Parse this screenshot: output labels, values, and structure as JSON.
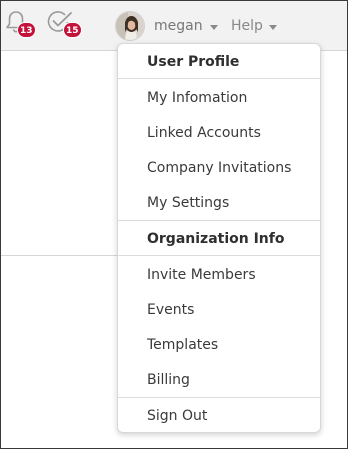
{
  "header": {
    "notifications": {
      "icon": "bell-icon",
      "count": "13"
    },
    "tasks": {
      "icon": "task-check-icon",
      "count": "15"
    },
    "user": {
      "name": "megan"
    },
    "help": {
      "label": "Help"
    },
    "badge_color": "#c4133a"
  },
  "user_menu": {
    "user_profile": "User Profile",
    "my_information": "My Infomation",
    "linked_accounts": "Linked Accounts",
    "company_invitations": "Company Invitations",
    "my_settings": "My Settings",
    "organization_info": "Organization Info",
    "invite_members": "Invite Members",
    "events": "Events",
    "templates": "Templates",
    "billing": "Billing",
    "sign_out": "Sign Out"
  }
}
